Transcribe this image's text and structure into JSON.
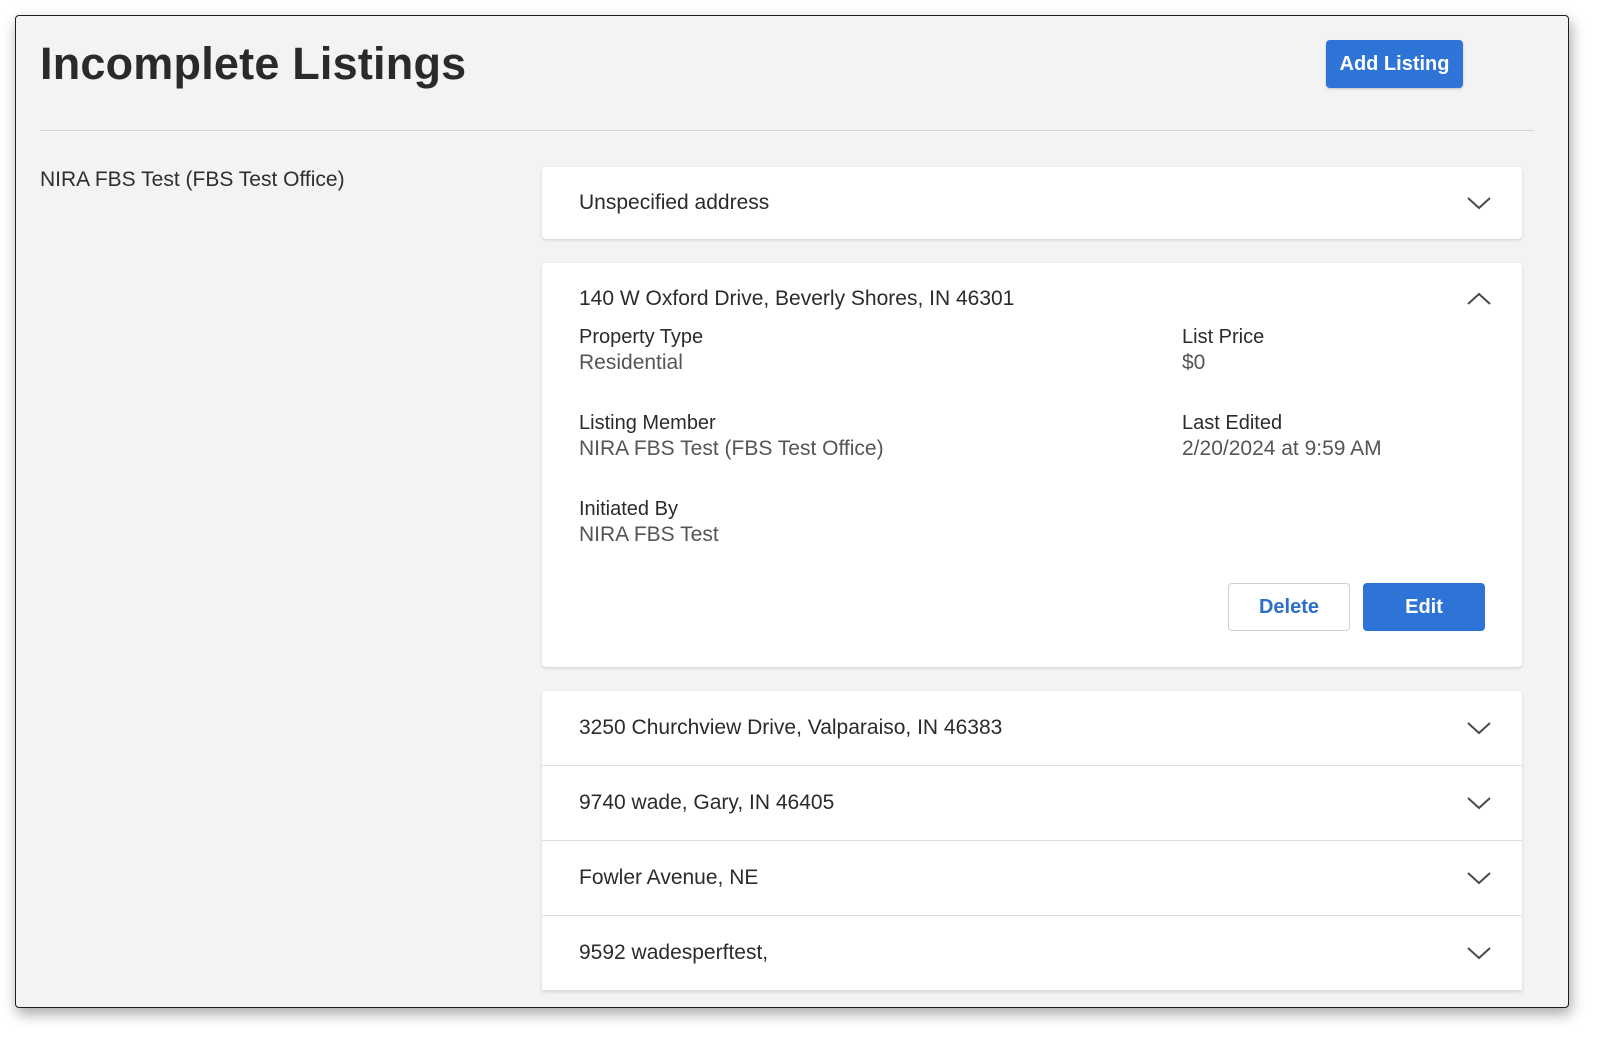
{
  "header": {
    "title": "Incomplete Listings",
    "add_button_label": "Add Listing"
  },
  "office": {
    "label": "NIRA FBS Test (FBS Test Office)"
  },
  "listings": [
    {
      "address": "Unspecified address",
      "expanded": false,
      "icon": "chevron-down-icon"
    },
    {
      "address": "140 W Oxford Drive, Beverly Shores, IN 46301",
      "expanded": true,
      "icon": "chevron-up-icon",
      "fields": {
        "property_type": {
          "label": "Property Type",
          "value": "Residential"
        },
        "list_price": {
          "label": "List Price",
          "value": "$0"
        },
        "listing_member": {
          "label": "Listing Member",
          "value": "NIRA FBS Test (FBS Test Office)"
        },
        "last_edited": {
          "label": "Last Edited",
          "value": "2/20/2024 at 9:59 AM"
        },
        "initiated_by": {
          "label": "Initiated By",
          "value": "NIRA FBS Test"
        }
      },
      "actions": {
        "delete_label": "Delete",
        "edit_label": "Edit"
      }
    },
    {
      "address": "3250 Churchview Drive, Valparaiso, IN 46383",
      "expanded": false,
      "icon": "chevron-down-icon"
    },
    {
      "address": "9740 wade, Gary, IN 46405",
      "expanded": false,
      "icon": "chevron-down-icon"
    },
    {
      "address": "Fowler Avenue, NE",
      "expanded": false,
      "icon": "chevron-down-icon"
    },
    {
      "address": "9592 wadesperftest,",
      "expanded": false,
      "icon": "chevron-down-icon"
    }
  ],
  "colors": {
    "primary": "#2d74d6",
    "page_bg": "#f3f3f3",
    "card_bg": "#ffffff"
  }
}
